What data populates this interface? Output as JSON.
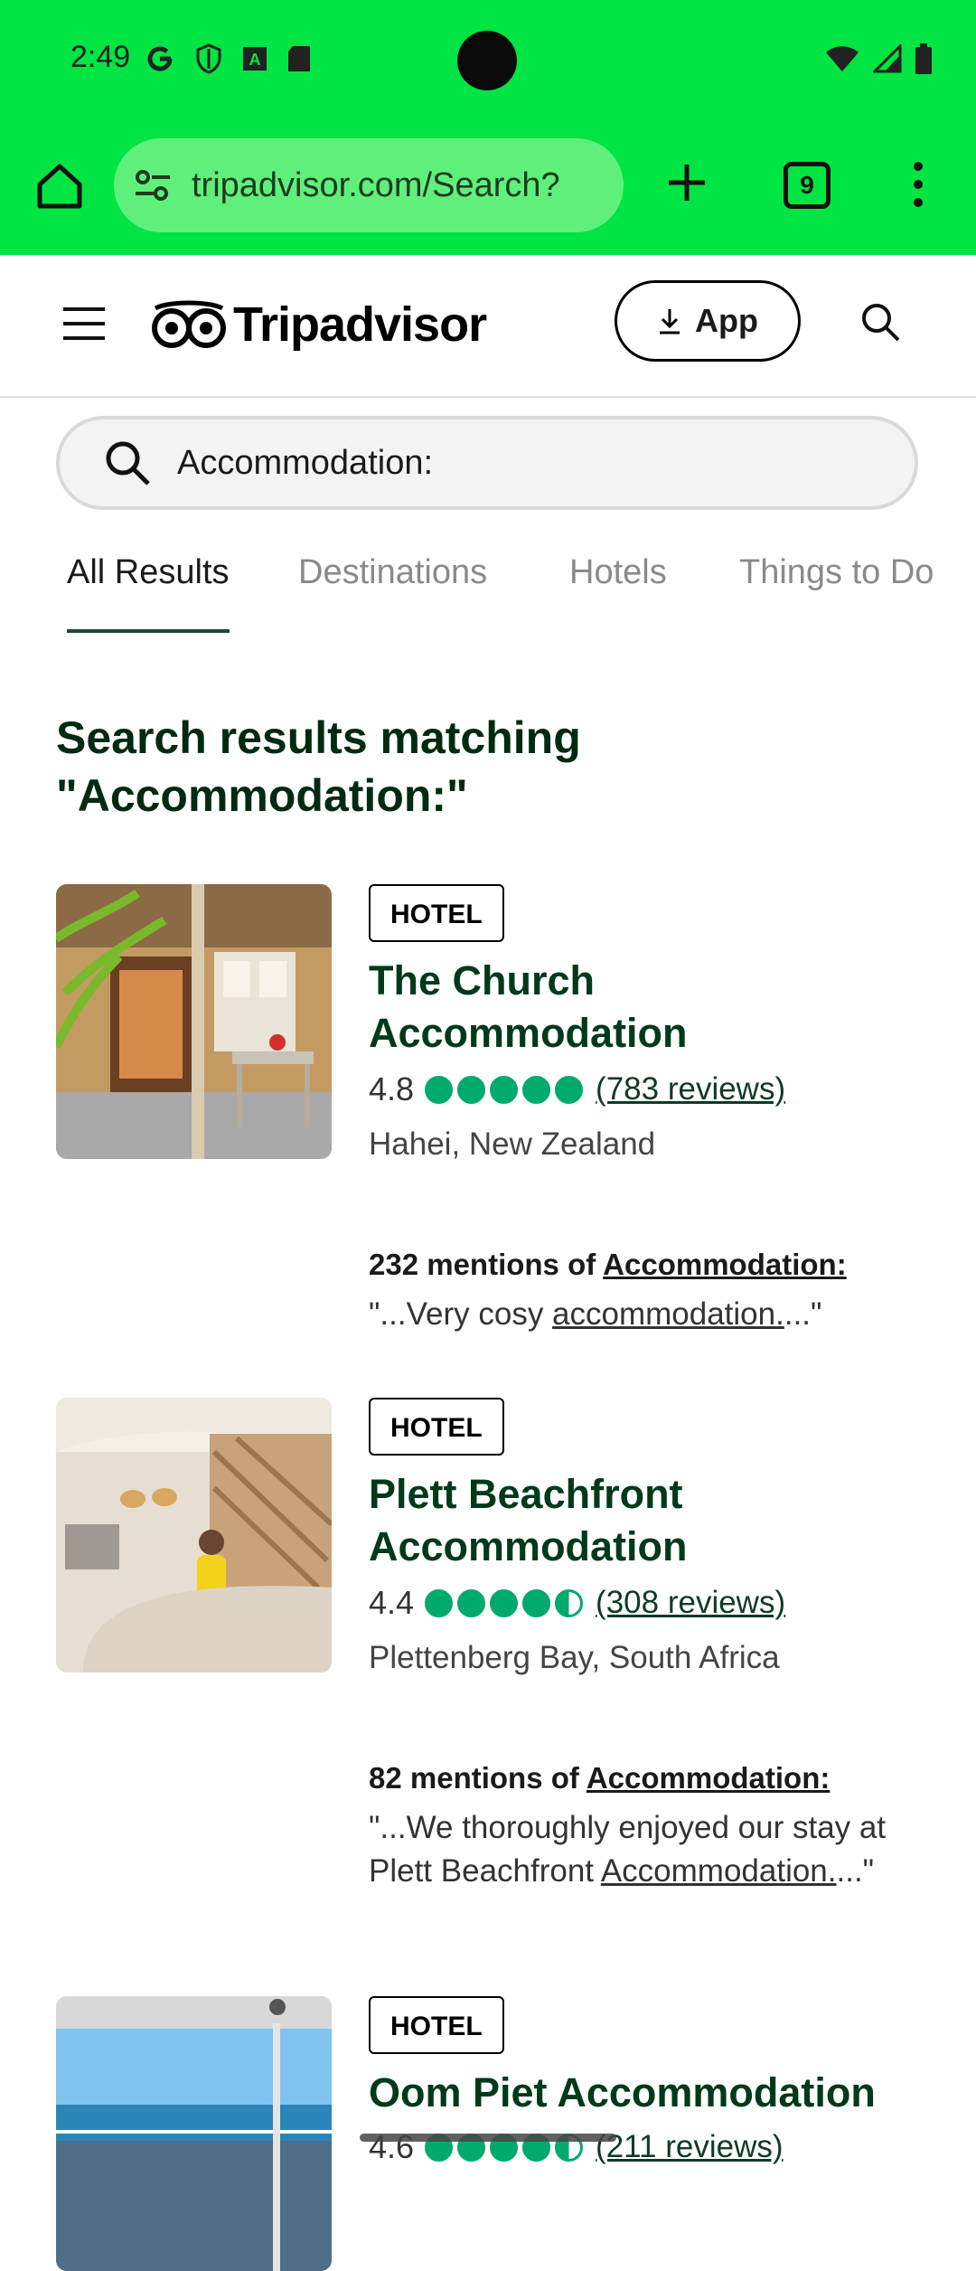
{
  "status_bar": {
    "time": "2:49"
  },
  "browser": {
    "url": "tripadvisor.com/Search?",
    "tab_count": "9"
  },
  "site": {
    "brand": "Tripadvisor",
    "app_button": "App"
  },
  "search": {
    "value": "Accommodation:"
  },
  "tabs": [
    {
      "label": "All Results",
      "active": true
    },
    {
      "label": "Destinations",
      "active": false
    },
    {
      "label": "Hotels",
      "active": false
    },
    {
      "label": "Things to Do",
      "active": false
    }
  ],
  "heading": {
    "line1": "Search results matching",
    "line2": "\"Accommodation:\""
  },
  "results": [
    {
      "badge": "HOTEL",
      "title_line1": "The Church",
      "title_line2": "Accommodation",
      "rating": "4.8",
      "rating_value": 4.8,
      "reviews": "(783 reviews)",
      "location": "Hahei, New Zealand",
      "mentions_prefix": "232 mentions of ",
      "mentions_term": "Accommodation:",
      "quote_pre": "\"...Very cosy ",
      "quote_link": "accommodation.",
      "quote_post": "...\""
    },
    {
      "badge": "HOTEL",
      "title_line1": "Plett Beachfront",
      "title_line2": "Accommodation",
      "rating": "4.4",
      "rating_value": 4.5,
      "reviews": "(308 reviews)",
      "location": "Plettenberg Bay, South Africa",
      "mentions_prefix": "82 mentions of ",
      "mentions_term": "Accommodation:",
      "quote_pre": "\"...We thoroughly enjoyed our stay at Plett Beachfront ",
      "quote_link": "Accommodation.",
      "quote_post": "...\""
    },
    {
      "badge": "HOTEL",
      "title_line1": "Oom Piet Accommodation",
      "rating": "4.6",
      "rating_value": 4.5,
      "reviews": "(211 reviews)"
    }
  ],
  "colors": {
    "chrome_green": "#00e444",
    "rating_green": "#00aa6c",
    "title_green": "#003a1a"
  }
}
